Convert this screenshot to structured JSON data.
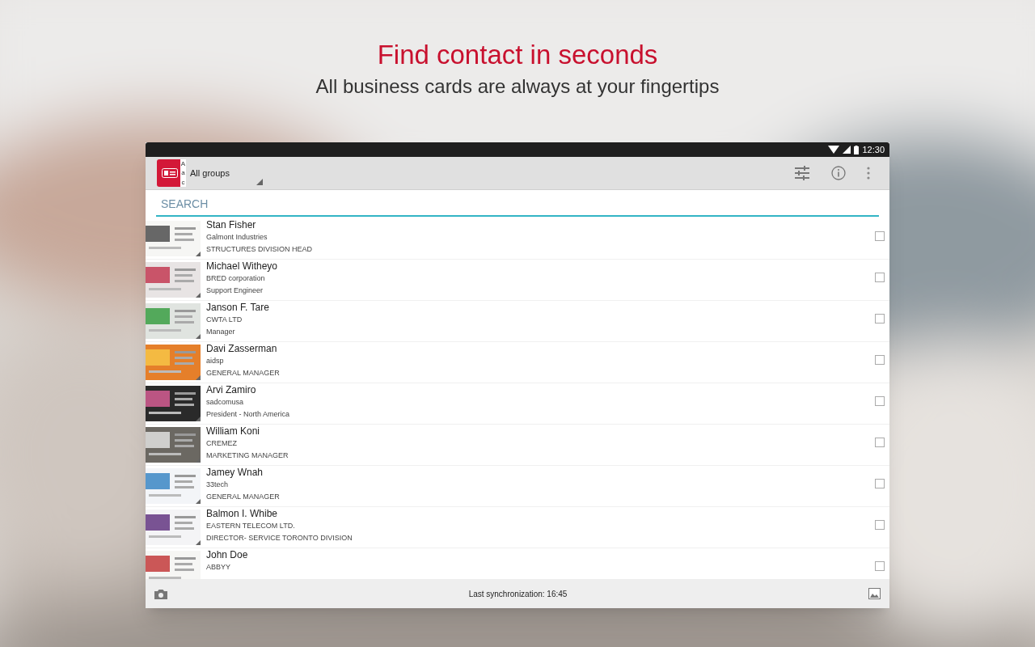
{
  "headline": "Find contact in seconds",
  "subtitle": "All business cards are always at your fingertips",
  "status_bar": {
    "time": "12:30"
  },
  "toolbar": {
    "logo_letters": [
      "A",
      "a",
      "c"
    ],
    "group": "All groups"
  },
  "search": {
    "placeholder": "SEARCH"
  },
  "contacts": [
    {
      "name": "Stan Fisher",
      "company": "Galmont  Industries",
      "title": "STRUCTURES DIVISION HEAD",
      "checked": false
    },
    {
      "name": "Michael Witheyo",
      "company": "BRED corporation",
      "title": "Support Engineer",
      "checked": false
    },
    {
      "name": "Janson F. Tare",
      "company": "CWTA LTD",
      "title": "Manager",
      "checked": false
    },
    {
      "name": "Davi Zasserman",
      "company": "aidsp",
      "title": "GENERAL MANAGER",
      "checked": false
    },
    {
      "name": "Arvi Zamiro",
      "company": "sadcomusa",
      "title": "President - North America",
      "checked": false
    },
    {
      "name": "William Koni",
      "company": "CREMEZ",
      "title": "MARKETING MANAGER",
      "checked": false
    },
    {
      "name": "Jamey Wnah",
      "company": "33tech",
      "title": "GENERAL MANAGER",
      "checked": false
    },
    {
      "name": "Balmon I. Whibe",
      "company": "EASTERN TELECOM LTD.",
      "title": "DIRECTOR- SERVICE TORONTO DIVISION",
      "checked": false
    },
    {
      "name": "John Doe",
      "company": "ABBYY",
      "checked": false
    }
  ],
  "bottom_bar": {
    "sync": "Last synchronization: 16:45"
  }
}
